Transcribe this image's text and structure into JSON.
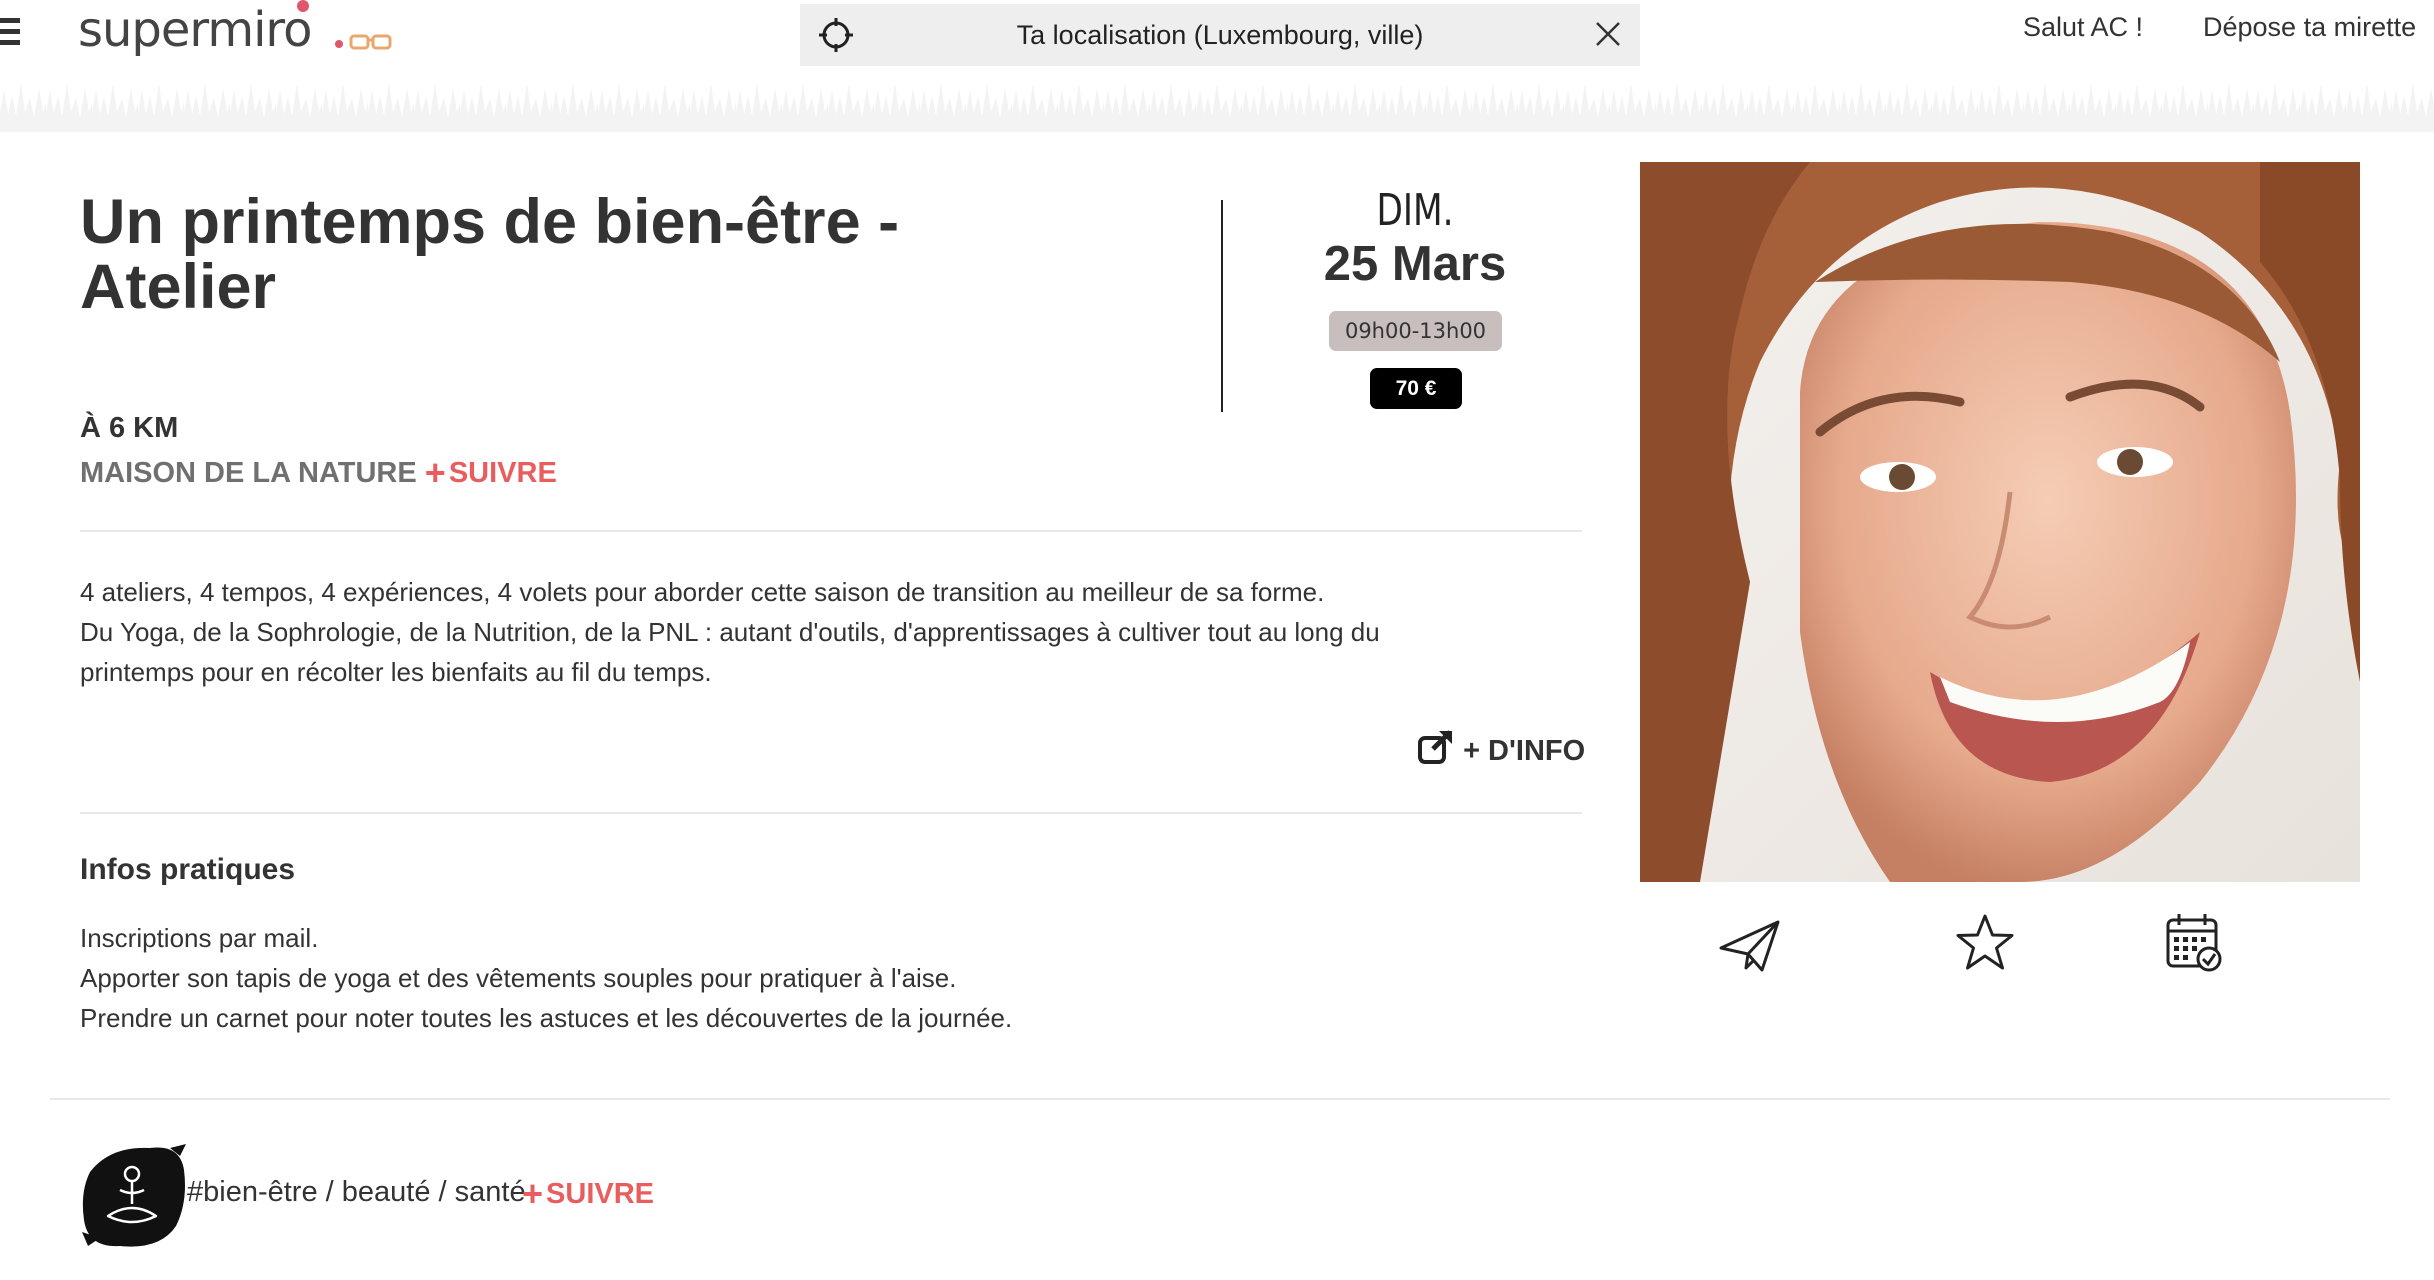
{
  "header": {
    "logo": "supermiro",
    "location_placeholder": "Ta localisation (Luxembourg, ville)",
    "greeting": "Salut AC !",
    "submit_link": "Dépose ta mirette"
  },
  "event": {
    "title": "Un printemps de bien-être - Atelier",
    "day": "DIM.",
    "date": "25 Mars",
    "hours": "09h00-13h00",
    "price": "70 €",
    "distance": "À 6 KM",
    "organizer": "MAISON DE LA NATURE",
    "follow_label": "SUIVRE",
    "description": [
      "4 ateliers, 4 tempos, 4 expériences, 4 volets pour aborder cette saison de transition au meilleur de sa forme.",
      "Du Yoga, de la Sophrologie, de la Nutrition, de la PNL : autant d'outils, d'apprentissages à cultiver tout au long du",
      "printemps pour en récolter les bienfaits au fil du temps."
    ],
    "more_info": "+ D'INFO"
  },
  "infos": {
    "title": "Infos pratiques",
    "lines": [
      "Inscriptions par mail.",
      "Apporter son tapis de yoga et des vêtements souples pour pratiquer à l'aise.",
      "Prendre un carnet pour noter toutes les astuces et les découvertes de la journée."
    ]
  },
  "category": {
    "label": "#bien-être / beauté / santé",
    "follow_label": "SUIVRE"
  },
  "icons": [
    "menu-icon",
    "location-target-icon",
    "close-icon",
    "external-link-icon",
    "send-icon",
    "star-icon",
    "calendar-check-icon",
    "meditation-icon"
  ],
  "colors": {
    "accent": "#e85e5e",
    "price_bg": "#000000",
    "hours_bg": "#c9bebe",
    "search_bg": "#eeeeee"
  }
}
